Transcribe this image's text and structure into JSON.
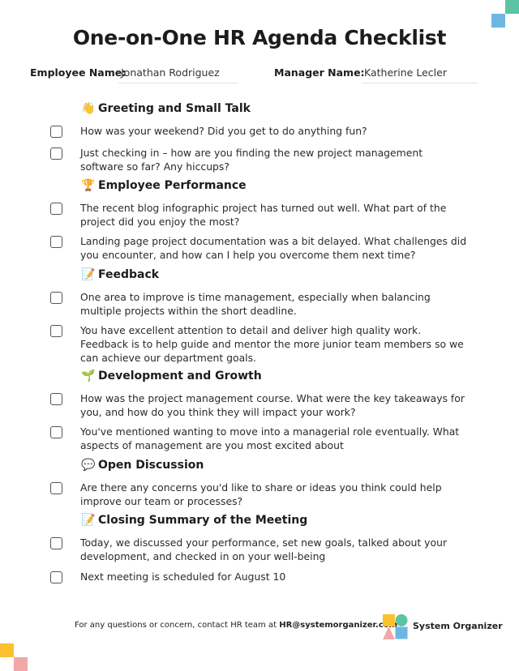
{
  "title": "One-on-One HR Agenda Checklist",
  "employee": {
    "label": "Employee Name:",
    "value": "Jonathan Rodriguez"
  },
  "manager": {
    "label": "Manager Name:",
    "value": "Katherine Lecler"
  },
  "sections": [
    {
      "icon": "👋",
      "icon_name": "waving-hand-icon",
      "heading": "Greeting and Small Talk",
      "items": [
        {
          "text": "How was your weekend? Did you get to do anything fun?",
          "checked": false
        },
        {
          "text": "Just checking in – how are you finding the new project management software so far? Any hiccups?",
          "checked": false
        }
      ]
    },
    {
      "icon": "🏆",
      "icon_name": "trophy-icon",
      "heading": "Employee Performance",
      "items": [
        {
          "text": "The recent blog infographic project has turned out well. What part of the project did you enjoy the most?",
          "checked": false
        },
        {
          "text": "Landing page project documentation was a bit delayed. What challenges did you encounter, and how can I help you overcome them next time?",
          "checked": false
        }
      ]
    },
    {
      "icon": "📝",
      "icon_name": "memo-pencil-icon",
      "heading": "Feedback",
      "items": [
        {
          "text": "One area to improve is time management, especially when balancing multiple projects within the short deadline.",
          "checked": false
        },
        {
          "text": "You have excellent attention to detail and deliver high quality work. Feedback is to help guide and mentor the more junior team members so we can achieve our department goals.",
          "checked": false
        }
      ]
    },
    {
      "icon": "🌱",
      "icon_name": "seedling-icon",
      "heading": "Development and Growth",
      "items": [
        {
          "text": "How was the project management course. What were the key takeaways for you, and how do you think they will impact your work?",
          "checked": false
        },
        {
          "text": "You've mentioned wanting to move into a managerial role eventually. What aspects of management are you most excited about",
          "checked": false
        }
      ]
    },
    {
      "icon": "💬",
      "icon_name": "speech-bubble-icon",
      "heading": "Open Discussion",
      "items": [
        {
          "text": "Are there any concerns you'd like to share or ideas you think could help improve our team or processes?",
          "checked": false
        }
      ]
    },
    {
      "icon": "📝",
      "icon_name": "memo-pencil-icon",
      "heading": "Closing Summary of the Meeting",
      "items": [
        {
          "text": "Today, we discussed your performance, set new goals, talked about your development, and checked in on your well-being",
          "checked": false
        },
        {
          "text": "Next meeting is scheduled for August 10",
          "checked": false
        }
      ]
    }
  ],
  "footer": {
    "text": "For any questions or concern, contact HR team at ",
    "email": "HR@systemorganizer.com",
    "brand": "System Organizer"
  },
  "colors": {
    "teal": "#5cc4a4",
    "blue": "#6eb6e0",
    "yellow": "#fcc12d",
    "pink": "#f2a7a7"
  }
}
